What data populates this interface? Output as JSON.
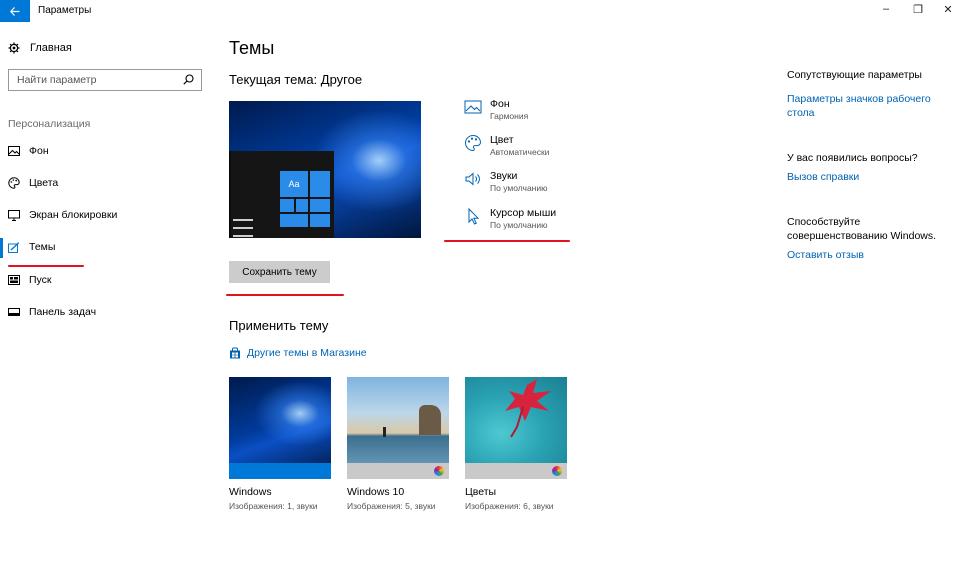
{
  "window": {
    "title": "Параметры",
    "back_icon": "arrow-left-icon",
    "controls": [
      "–",
      "❐",
      "✕"
    ]
  },
  "sidebar": {
    "home_label": "Главная",
    "search_placeholder": "Найти параметр",
    "section_label": "Персонализация",
    "items": [
      {
        "label": "Фон",
        "icon": "picture-icon"
      },
      {
        "label": "Цвета",
        "icon": "palette-icon"
      },
      {
        "label": "Экран блокировки",
        "icon": "monitor-icon"
      },
      {
        "label": "Темы",
        "icon": "brush-icon",
        "active": true
      },
      {
        "label": "Пуск",
        "icon": "start-grid-icon"
      },
      {
        "label": "Панель задач",
        "icon": "taskbar-icon"
      }
    ]
  },
  "main": {
    "title": "Темы",
    "current_theme": "Текущая тема: Другое",
    "preview_tile": "Aa",
    "properties": [
      {
        "name": "Фон",
        "value": "Гармония",
        "icon": "picture-icon"
      },
      {
        "name": "Цвет",
        "value": "Автоматически",
        "icon": "palette-icon"
      },
      {
        "name": "Звуки",
        "value": "По умолчанию",
        "icon": "speaker-icon"
      },
      {
        "name": "Курсор мыши",
        "value": "По умолчанию",
        "icon": "cursor-icon"
      }
    ],
    "save_button": "Сохранить тему",
    "apply_title": "Применить тему",
    "store_link": "Другие темы в Магазине",
    "themes": [
      {
        "name": "Windows",
        "meta": "Изображения: 1, звуки"
      },
      {
        "name": "Windows 10",
        "meta": "Изображения: 5, звуки"
      },
      {
        "name": "Цветы",
        "meta": "Изображения: 6, звуки"
      }
    ]
  },
  "related": {
    "heading": "Сопутствующие параметры",
    "link1_line1": "Параметры значков рабочего",
    "link1_line2": "стола",
    "question": "У вас появились вопросы?",
    "help_link": "Вызов справки",
    "improve_line1": "Способствуйте",
    "improve_line2": "совершенствованию Windows.",
    "feedback_link": "Оставить отзыв"
  },
  "colors": {
    "accent": "#0078d7",
    "link": "#0063b1",
    "annotation": "#e0141e"
  }
}
